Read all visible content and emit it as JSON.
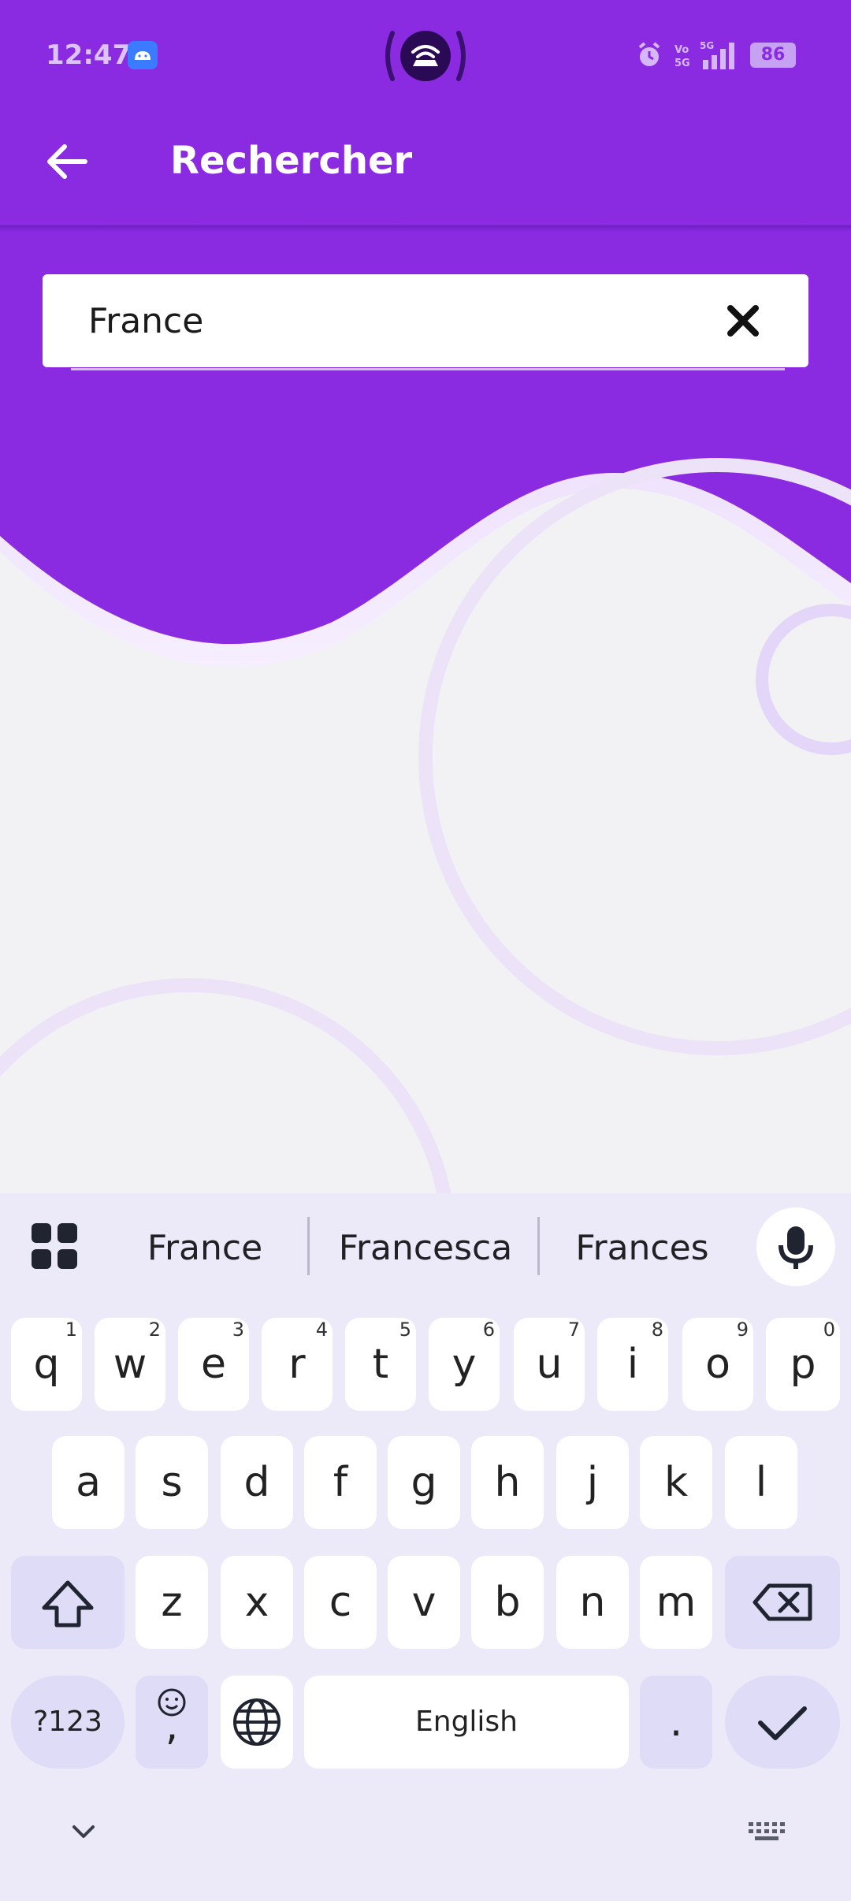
{
  "status_bar": {
    "time": "12:47",
    "battery": "86",
    "icons": [
      "android-icon",
      "hotspot-icon",
      "alarm-icon",
      "volte-icon",
      "5g-signal-icon",
      "battery-icon"
    ]
  },
  "app_bar": {
    "title": "Rechercher",
    "back_icon": "arrow-left-icon"
  },
  "search": {
    "value": "France",
    "clear_icon": "close-icon"
  },
  "keyboard": {
    "suggestions": [
      "France",
      "Francesca",
      "Frances"
    ],
    "row1": [
      {
        "label": "q",
        "hint": "1"
      },
      {
        "label": "w",
        "hint": "2"
      },
      {
        "label": "e",
        "hint": "3"
      },
      {
        "label": "r",
        "hint": "4"
      },
      {
        "label": "t",
        "hint": "5"
      },
      {
        "label": "y",
        "hint": "6"
      },
      {
        "label": "u",
        "hint": "7"
      },
      {
        "label": "i",
        "hint": "8"
      },
      {
        "label": "o",
        "hint": "9"
      },
      {
        "label": "p",
        "hint": "0"
      }
    ],
    "row2": [
      "a",
      "s",
      "d",
      "f",
      "g",
      "h",
      "j",
      "k",
      "l"
    ],
    "row3": [
      "z",
      "x",
      "c",
      "v",
      "b",
      "n",
      "m"
    ],
    "symbols_label": "?123",
    "comma_label": ",",
    "space_label": "English",
    "period_label": ".",
    "colors": {
      "primary": "#8a2be2",
      "keyboard_bg": "#eceaf8",
      "modifier_key": "#dedcf6"
    }
  }
}
